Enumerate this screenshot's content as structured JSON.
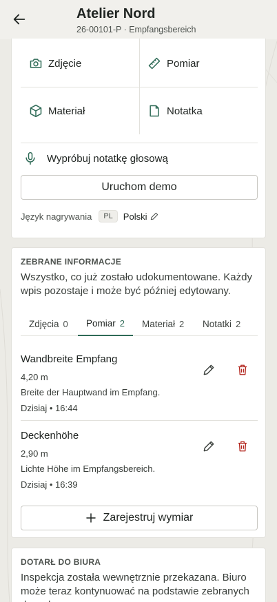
{
  "header": {
    "title": "Atelier Nord",
    "subtitle": "26-00101-P · Empfangsbereich"
  },
  "capture": {
    "tiles": [
      {
        "label": "Zdjęcie",
        "icon": "camera-icon"
      },
      {
        "label": "Pomiar",
        "icon": "ruler-icon"
      },
      {
        "label": "Materiał",
        "icon": "box-icon"
      },
      {
        "label": "Notatka",
        "icon": "note-icon"
      }
    ],
    "voice_label": "Wypróbuj notatkę głosową",
    "demo_button": "Uruchom demo",
    "language_label": "Język nagrywania",
    "language_code": "PL",
    "language_name": "Polski"
  },
  "collected": {
    "heading": "ZEBRANE INFORMACJE",
    "description": "Wszystko, co już zostało udokumentowane. Każdy wpis pozostaje i może być później edytowany.",
    "tabs": [
      {
        "label": "Zdjęcia",
        "count": "0"
      },
      {
        "label": "Pomiar",
        "count": "2"
      },
      {
        "label": "Materiał",
        "count": "2"
      },
      {
        "label": "Notatki",
        "count": "2"
      }
    ],
    "active_tab": "Pomiar",
    "items": [
      {
        "title": "Wandbreite Empfang",
        "value": "4,20 m",
        "description": "Breite der Hauptwand im Empfang.",
        "time": "Dzisiaj • 16:44"
      },
      {
        "title": "Deckenhöhe",
        "value": "2,90 m",
        "description": "Lichte Höhe im Empfangsbereich.",
        "time": "Dzisiaj • 16:39"
      }
    ],
    "add_button": "Zarejestruj wymiar"
  },
  "office": {
    "heading": "DOTARŁ DO BIURA",
    "description": "Inspekcja została wewnętrznie przekazana. Biuro może teraz kontynuować na podstawie zebranych danych."
  },
  "colors": {
    "accent": "#2f6b57",
    "danger": "#b3261e",
    "background": "#ecebe6",
    "card": "#ffffff"
  }
}
